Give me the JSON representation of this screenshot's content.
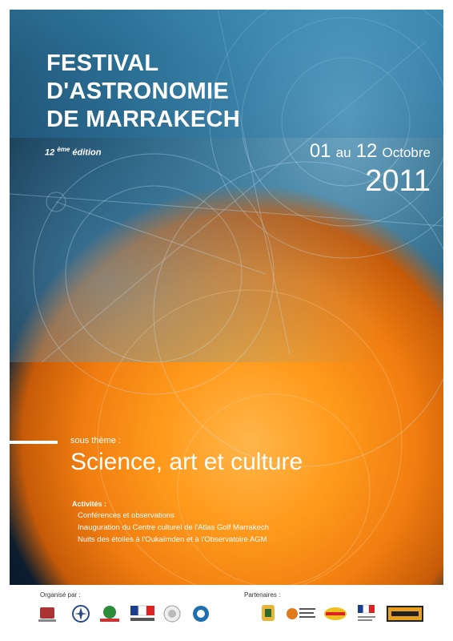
{
  "header": {
    "title_line1": "FESTIVAL",
    "title_line2_prefix": "D'",
    "title_line2_main": "ASTRONOMIE",
    "title_line3": "DE MARRAKECH",
    "edition_number": "12",
    "edition_sup": "ème",
    "edition_word": "édition"
  },
  "dates": {
    "day_start": "01",
    "connector": "au",
    "day_end": "12",
    "month": "Octobre",
    "year": "2011"
  },
  "theme": {
    "label": "sous thème :",
    "title": "Science, art et culture"
  },
  "activities": {
    "title": "Activités :",
    "items": [
      "Conférences et observations",
      "Inauguration du Centre culturel de l'Atlas Golf Marrakech",
      "Nuits des étoiles à l'Oukaïmden et à l'Observatoire AGM"
    ]
  },
  "footer": {
    "organised_label": "Organisé par :",
    "partners_label": "Partenaires :"
  },
  "colors": {
    "sky_dark": "#0f2c42",
    "sky_light": "#3c7897",
    "sun_core": "#ffb64a",
    "sun_edge": "#f07d10"
  }
}
